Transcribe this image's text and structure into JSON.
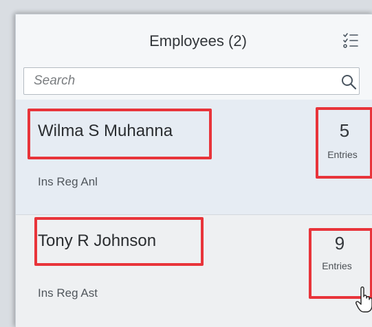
{
  "header": {
    "title": "Employees (2)"
  },
  "search": {
    "placeholder": "Search",
    "value": ""
  },
  "employees": [
    {
      "name": "Wilma S Muhanna",
      "position": "Ins Reg Anl",
      "count": "5",
      "unit": "Entries"
    },
    {
      "name": "Tony R Johnson",
      "position": "Ins Reg Ast",
      "count": "9",
      "unit": "Entries"
    }
  ],
  "colors": {
    "highlight": "#e8343a",
    "selected_row": "#e6ecf3",
    "accent": "#0a6ed1"
  },
  "icons": [
    "list-settings-icon",
    "search-icon",
    "hand-cursor-icon"
  ]
}
